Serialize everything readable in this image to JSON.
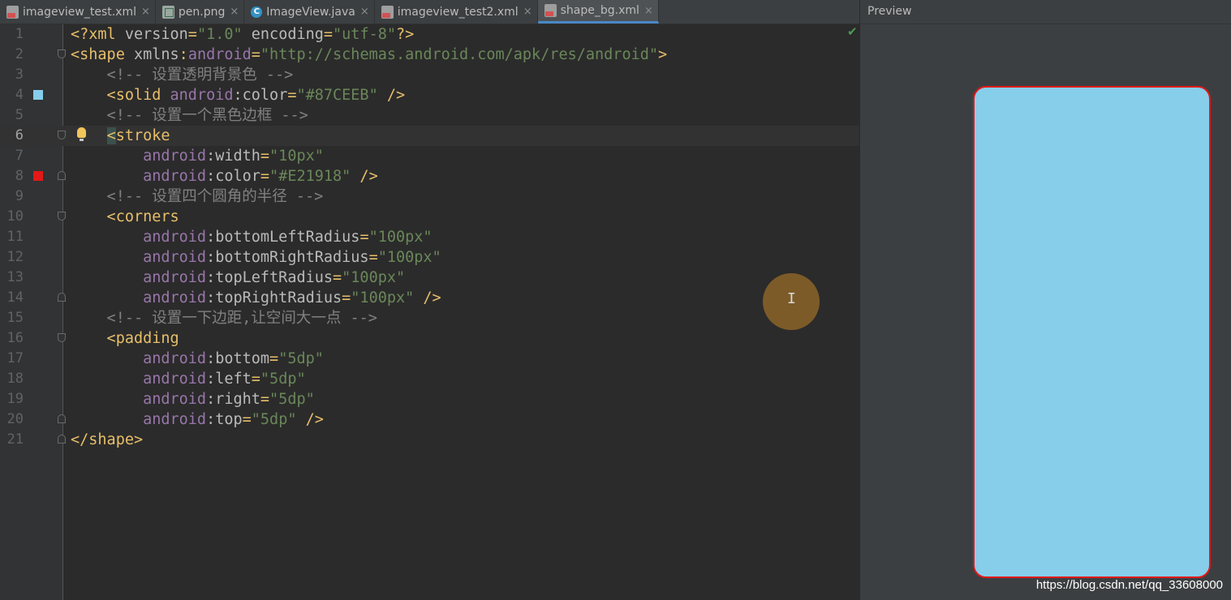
{
  "tabs": [
    {
      "label": "imageview_test.xml",
      "icon": "xml-file-icon",
      "active": false
    },
    {
      "label": "pen.png",
      "icon": "png-file-icon",
      "active": false
    },
    {
      "label": "ImageView.java",
      "icon": "java-class-icon",
      "active": false
    },
    {
      "label": "imageview_test2.xml",
      "icon": "xml-file-icon",
      "active": false
    },
    {
      "label": "shape_bg.xml",
      "icon": "xml-file-icon",
      "active": true
    }
  ],
  "tab_close_glyph": "×",
  "java_icon_letter": "C",
  "preview": {
    "title": "Preview",
    "fill_color": "#87CEEB",
    "stroke_color": "#E21918"
  },
  "watermark": "https://blog.csdn.net/qq_33608000",
  "editor": {
    "current_line": 6,
    "lines": [
      {
        "n": "1",
        "tokens": [
          [
            "pi",
            "<?xml "
          ],
          [
            "attr",
            "version"
          ],
          [
            "pi",
            "="
          ],
          [
            "val",
            "\"1.0\""
          ],
          [
            "attr",
            " encoding"
          ],
          [
            "pi",
            "="
          ],
          [
            "val",
            "\"utf-8\""
          ],
          [
            "pi",
            "?>"
          ]
        ]
      },
      {
        "n": "2",
        "tokens": [
          [
            "tag",
            "<shape "
          ],
          [
            "attr",
            "xmlns"
          ],
          [
            "pi",
            ":"
          ],
          [
            "ns",
            "android"
          ],
          [
            "pi",
            "="
          ],
          [
            "val",
            "\"http://schemas.android.com/apk/res/android\""
          ],
          [
            "tag",
            ">"
          ]
        ]
      },
      {
        "n": "3",
        "tokens": [
          [
            "cmt",
            "    <!-- 设置透明背景色 -->"
          ]
        ]
      },
      {
        "n": "4",
        "tokens": [
          [
            "tag",
            "    <solid "
          ],
          [
            "ns",
            "android"
          ],
          [
            "attr",
            ":color"
          ],
          [
            "pi",
            "="
          ],
          [
            "val",
            "\"#87CEEB\""
          ],
          [
            "tag",
            " />"
          ]
        ]
      },
      {
        "n": "5",
        "tokens": [
          [
            "cmt",
            "    <!-- 设置一个黑色边框 -->"
          ]
        ]
      },
      {
        "n": "6",
        "tokens": [
          [
            "tag",
            "    <stroke"
          ]
        ]
      },
      {
        "n": "7",
        "tokens": [
          [
            "ns",
            "        android"
          ],
          [
            "attr",
            ":width"
          ],
          [
            "pi",
            "="
          ],
          [
            "val",
            "\"10px\""
          ]
        ]
      },
      {
        "n": "8",
        "tokens": [
          [
            "ns",
            "        android"
          ],
          [
            "attr",
            ":color"
          ],
          [
            "pi",
            "="
          ],
          [
            "val",
            "\"#E21918\""
          ],
          [
            "tag",
            " />"
          ]
        ]
      },
      {
        "n": "9",
        "tokens": [
          [
            "cmt",
            "    <!-- 设置四个圆角的半径 -->"
          ]
        ]
      },
      {
        "n": "10",
        "tokens": [
          [
            "tag",
            "    <corners"
          ]
        ]
      },
      {
        "n": "11",
        "tokens": [
          [
            "ns",
            "        android"
          ],
          [
            "attr",
            ":bottomLeftRadius"
          ],
          [
            "pi",
            "="
          ],
          [
            "val",
            "\"100px\""
          ]
        ]
      },
      {
        "n": "12",
        "tokens": [
          [
            "ns",
            "        android"
          ],
          [
            "attr",
            ":bottomRightRadius"
          ],
          [
            "pi",
            "="
          ],
          [
            "val",
            "\"100px\""
          ]
        ]
      },
      {
        "n": "13",
        "tokens": [
          [
            "ns",
            "        android"
          ],
          [
            "attr",
            ":topLeftRadius"
          ],
          [
            "pi",
            "="
          ],
          [
            "val",
            "\"100px\""
          ]
        ]
      },
      {
        "n": "14",
        "tokens": [
          [
            "ns",
            "        android"
          ],
          [
            "attr",
            ":topRightRadius"
          ],
          [
            "pi",
            "="
          ],
          [
            "val",
            "\"100px\""
          ],
          [
            "tag",
            " />"
          ]
        ]
      },
      {
        "n": "15",
        "tokens": [
          [
            "cmt",
            "    <!-- 设置一下边距,让空间大一点 -->"
          ]
        ]
      },
      {
        "n": "16",
        "tokens": [
          [
            "tag",
            "    <padding"
          ]
        ]
      },
      {
        "n": "17",
        "tokens": [
          [
            "ns",
            "        android"
          ],
          [
            "attr",
            ":bottom"
          ],
          [
            "pi",
            "="
          ],
          [
            "val",
            "\"5dp\""
          ]
        ]
      },
      {
        "n": "18",
        "tokens": [
          [
            "ns",
            "        android"
          ],
          [
            "attr",
            ":left"
          ],
          [
            "pi",
            "="
          ],
          [
            "val",
            "\"5dp\""
          ]
        ]
      },
      {
        "n": "19",
        "tokens": [
          [
            "ns",
            "        android"
          ],
          [
            "attr",
            ":right"
          ],
          [
            "pi",
            "="
          ],
          [
            "val",
            "\"5dp\""
          ]
        ]
      },
      {
        "n": "20",
        "tokens": [
          [
            "ns",
            "        android"
          ],
          [
            "attr",
            ":top"
          ],
          [
            "pi",
            "="
          ],
          [
            "val",
            "\"5dp\""
          ],
          [
            "tag",
            " />"
          ]
        ]
      },
      {
        "n": "21",
        "tokens": [
          [
            "tag",
            "</shape>"
          ]
        ]
      }
    ]
  },
  "gutter_swatches": {
    "4": "#87CEEB",
    "8": "#E21918"
  },
  "fold_open_lines": [
    2,
    6,
    10,
    16
  ],
  "fold_close_lines": [
    8,
    14,
    20,
    21
  ],
  "bulb_line": 6,
  "cursor_glyph": "I",
  "check_glyph": "✔"
}
